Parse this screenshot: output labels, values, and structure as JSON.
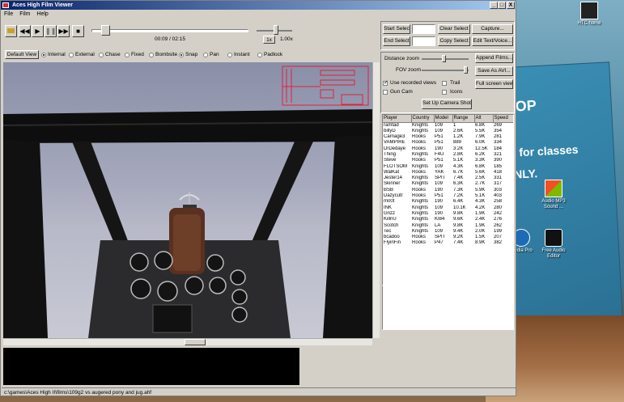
{
  "window": {
    "title": "Aces High Film Viewer",
    "minimize": "_",
    "maximize": "□",
    "close": "X"
  },
  "menu": {
    "items": [
      "File",
      "Film",
      "Help"
    ]
  },
  "transport": {
    "time": "00:09 / 02:15",
    "speed_label": "1x",
    "speed_value": "1.00x",
    "playback_progress": 0.067
  },
  "views": {
    "default_view": "Default View",
    "options": [
      {
        "label": "Internal",
        "selected": true
      },
      {
        "label": "External",
        "selected": false
      },
      {
        "label": "Chase",
        "selected": false
      },
      {
        "label": "Fixed",
        "selected": false
      },
      {
        "label": "Bombsite",
        "selected": false
      },
      {
        "label": "Snap",
        "selected": true
      },
      {
        "label": "Pan",
        "selected": false
      },
      {
        "label": "Instant",
        "selected": false
      },
      {
        "label": "Padlock",
        "selected": false
      }
    ]
  },
  "controls": {
    "start_select": "Start Select",
    "end_select": "End Select",
    "clear_select": "Clear Select",
    "copy_select": "Copy Select",
    "capture": "Capture...",
    "edit_text_voice": "Edit Text/Voice...",
    "distance_zoom": "Distance zoom",
    "fov_zoom": "FOV zoom",
    "append_films": "Append Films...",
    "save_as_avi": "Save As AVI...",
    "use_recorded_views": "Use recorded views",
    "trail": "Trail",
    "gun_cam": "Gun Cam",
    "icons": "Icons",
    "full_screen_view": "Full screen view",
    "set_up_camera_shots": "Set Up Camera Shots"
  },
  "checks": {
    "use_recorded_views": true,
    "trail": false,
    "gun_cam": false,
    "icons": false
  },
  "table": {
    "columns": [
      "Player",
      "Country",
      "Model",
      "Range",
      "Alt",
      "Speed"
    ],
    "rows": [
      [
        "ramtad",
        "Knights",
        "109",
        "1",
        "6.8K",
        "269"
      ],
      [
        "billyD",
        "Knights",
        "109",
        "2.6K",
        "5.5K",
        "354"
      ],
      [
        "Carnage3",
        "Rooks",
        "P51",
        "1.2K",
        "7.9K",
        "281"
      ],
      [
        "VAMPIRE",
        "Rooks",
        "P51",
        "889",
        "6.0K",
        "334"
      ],
      [
        "DrDedaye",
        "Rooks",
        "190",
        "3.2K",
        "12.5K",
        "184"
      ],
      [
        "Thing",
        "Knights",
        "F4U",
        "2.8K",
        "6.2K",
        "321"
      ],
      [
        "Steve",
        "Rooks",
        "P51",
        "5.1K",
        "3.3K",
        "390"
      ],
      [
        "FLOTSOM",
        "Knights",
        "109",
        "4.3K",
        "6.8K",
        "185"
      ],
      [
        "WalKat",
        "Rooks",
        "YAK",
        "6.7K",
        "5.6K",
        "418"
      ],
      [
        "Jester14",
        "Knights",
        "SPIT",
        "7.4K",
        "2.5K",
        "331"
      ],
      [
        "Skinner",
        "Knights",
        "109",
        "6.3K",
        "2.7K",
        "317"
      ],
      [
        "BSB",
        "Rooks",
        "190",
        "7.3K",
        "5.9K",
        "303"
      ],
      [
        "Dazycutr",
        "Rooks",
        "P51",
        "7.2K",
        "5.1K",
        "403"
      ],
      [
        "m00t",
        "Knights",
        "190",
        "6.4K",
        "4.3K",
        "258"
      ],
      [
        "INK",
        "Knights",
        "109",
        "10.1K",
        "4.2K",
        "280"
      ],
      [
        "Grizz",
        "Knights",
        "190",
        "9.8K",
        "1.9K",
        "242"
      ],
      [
        "KillnU",
        "Knights",
        "KI84",
        "9.6K",
        "2.4K",
        "276"
      ],
      [
        "Scotch",
        "Knights",
        "LA",
        "9.8K",
        "1.9K",
        "262"
      ],
      [
        "Tec",
        "Knights",
        "109",
        "9.4K",
        "2.0K",
        "199"
      ],
      [
        "bcadoo",
        "Rooks",
        "SPIT",
        "9.2K",
        "1.5K",
        "207"
      ],
      [
        "FlyinFin",
        "Rooks",
        "P47",
        "7.4K",
        "8.9K",
        "382"
      ]
    ]
  },
  "status": {
    "path": "c:\\games\\Aces High II\\films\\109g2 vs augered pony and jug.ahf"
  },
  "desktop": {
    "icons": [
      {
        "label": "HTC home",
        "icon": "htc-home-icon"
      },
      {
        "label": "Audio MP3 Sound ...",
        "icon": "audio-mp3-icon"
      },
      {
        "label": "Free Audio Editor",
        "icon": "free-audio-editor-icon"
      },
      {
        "label": "Media Pro",
        "icon": "media-pro-icon"
      }
    ],
    "poster_lines": [
      "OP",
      "e for classes",
      "NLY."
    ]
  },
  "colors": {
    "titlebar": "#0a246a",
    "window": "#d4d0c8",
    "hud": "#e0213a"
  }
}
